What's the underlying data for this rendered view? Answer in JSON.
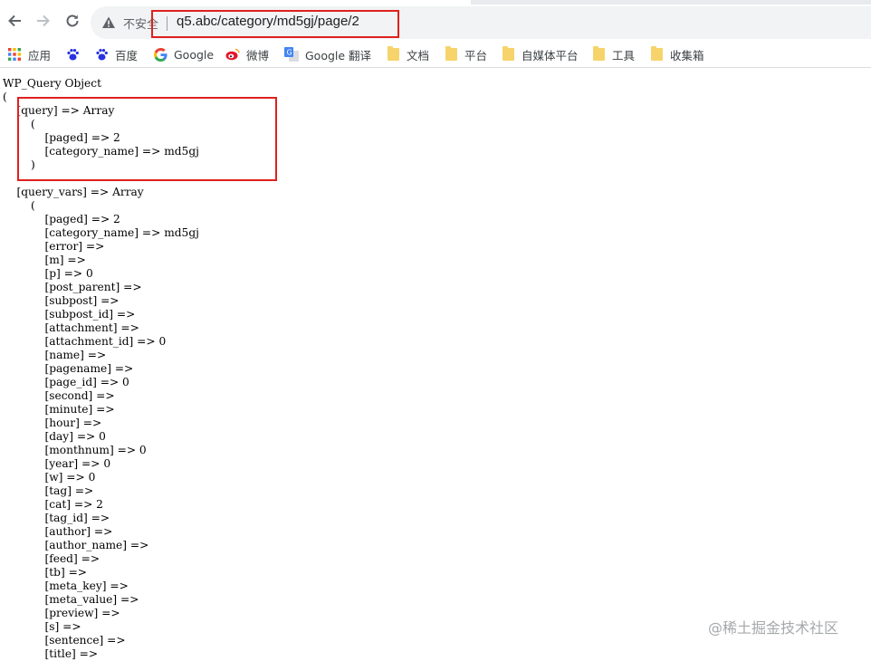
{
  "toolbar": {
    "security_label": "不安全",
    "url": "q5.abc/category/md5gj/page/2"
  },
  "bookmarks": [
    {
      "label": "应用",
      "icon": "apps-grid-icon"
    },
    {
      "label": "",
      "icon": "baidu-paw-icon"
    },
    {
      "label": "百度",
      "icon": "baidu-paw-icon"
    },
    {
      "label": "Google",
      "icon": "google-g-icon"
    },
    {
      "label": "微博",
      "icon": "weibo-icon"
    },
    {
      "label": "Google 翻译",
      "icon": "google-translate-icon"
    },
    {
      "label": "文档",
      "icon": "folder-icon"
    },
    {
      "label": "平台",
      "icon": "folder-icon"
    },
    {
      "label": "自媒体平台",
      "icon": "folder-icon"
    },
    {
      "label": "工具",
      "icon": "folder-icon"
    },
    {
      "label": "收集箱",
      "icon": "folder-icon"
    }
  ],
  "colors": {
    "highlight": "#e0201e",
    "folder": "#f6d46b"
  },
  "content": {
    "lines": [
      "WP_Query Object",
      "(",
      "    [query] => Array",
      "        (",
      "            [paged] => 2",
      "            [category_name] => md5gj",
      "        )",
      "",
      "    [query_vars] => Array",
      "        (",
      "            [paged] => 2",
      "            [category_name] => md5gj",
      "            [error] => ",
      "            [m] => ",
      "            [p] => 0",
      "            [post_parent] => ",
      "            [subpost] => ",
      "            [subpost_id] => ",
      "            [attachment] => ",
      "            [attachment_id] => 0",
      "            [name] => ",
      "            [pagename] => ",
      "            [page_id] => 0",
      "            [second] => ",
      "            [minute] => ",
      "            [hour] => ",
      "            [day] => 0",
      "            [monthnum] => 0",
      "            [year] => 0",
      "            [w] => 0",
      "            [tag] => ",
      "            [cat] => 2",
      "            [tag_id] => ",
      "            [author] => ",
      "            [author_name] => ",
      "            [feed] => ",
      "            [tb] => ",
      "            [meta_key] => ",
      "            [meta_value] => ",
      "            [preview] => ",
      "            [s] => ",
      "            [sentence] => ",
      "            [title] => "
    ]
  },
  "watermark": "@稀土掘金技术社区"
}
